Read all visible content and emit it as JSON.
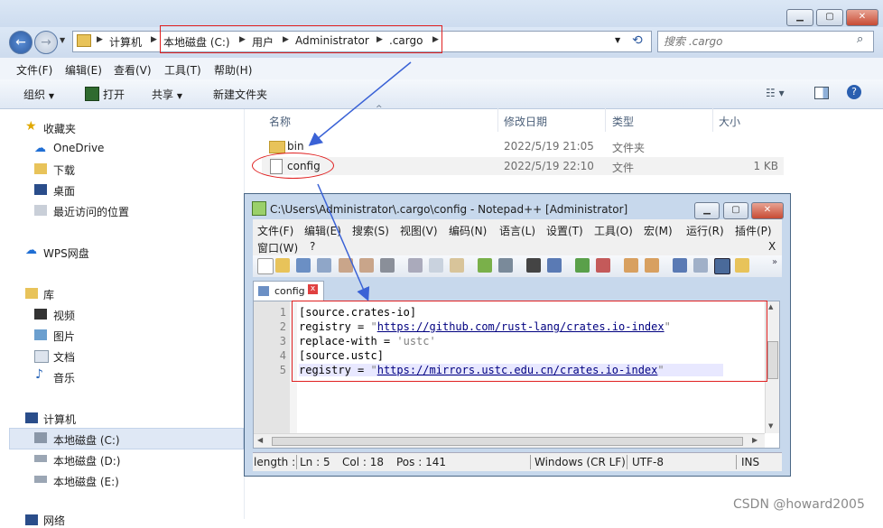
{
  "explorer": {
    "back_icon": "back-arrow-icon",
    "forward_icon": "forward-arrow-icon",
    "address": {
      "computer": "计算机",
      "drive": "本地磁盘 (C:)",
      "users": "用户",
      "admin": "Administrator",
      "folder": ".cargo"
    },
    "search_placeholder": "搜索 .cargo",
    "menu": [
      "文件(F)",
      "编辑(E)",
      "查看(V)",
      "工具(T)",
      "帮助(H)"
    ],
    "toolbar": {
      "organize": "组织",
      "open": "打开",
      "share": "共享",
      "new_folder": "新建文件夹"
    },
    "sidebar": {
      "favorites": "收藏夹",
      "onedrive": "OneDrive",
      "downloads": "下载",
      "desktop": "桌面",
      "recent": "最近访问的位置",
      "wps": "WPS网盘",
      "library": "库",
      "videos": "视频",
      "pictures": "图片",
      "documents": "文档",
      "music": "音乐",
      "computer": "计算机",
      "drive_c": "本地磁盘 (C:)",
      "drive_d": "本地磁盘 (D:)",
      "drive_e": "本地磁盘 (E:)",
      "network": "网络"
    },
    "columns": {
      "name": "名称",
      "date": "修改日期",
      "type": "类型",
      "size": "大小"
    },
    "files": [
      {
        "name": "bin",
        "date": "2022/5/19 21:05",
        "type": "文件夹",
        "size": ""
      },
      {
        "name": "config",
        "date": "2022/5/19 22:10",
        "type": "文件",
        "size": "1 KB"
      }
    ]
  },
  "notepad": {
    "title": "C:\\Users\\Administrator\\.cargo\\config - Notepad++ [Administrator]",
    "menu": [
      "文件(F)",
      "编辑(E)",
      "搜索(S)",
      "视图(V)",
      "编码(N)",
      "语言(L)",
      "设置(T)",
      "工具(O)",
      "宏(M)",
      "运行(R)",
      "插件(P)"
    ],
    "menu_row2": [
      "窗口(W)",
      "?"
    ],
    "close_x": "X",
    "tab": "config",
    "lines": [
      "1",
      "2",
      "3",
      "4",
      "5"
    ],
    "code": {
      "l1": "[source.crates-io]",
      "l2_key": "registry = ",
      "l2_q1": "\"",
      "l2_url": "https://github.com/rust-lang/crates.io-index",
      "l2_q2": "\"",
      "l3_key": "replace-with = ",
      "l3_val": "'ustc'",
      "l4": "[source.ustc]",
      "l5_key": "registry = ",
      "l5_q1": "\"",
      "l5_url": "https://mirrors.ustc.edu.cn/crates.io-index",
      "l5_q2": "\""
    },
    "status": {
      "length": "length :",
      "ln": "Ln : 5",
      "col": "Col : 18",
      "pos": "Pos : 141",
      "eol": "Windows (CR LF)",
      "enc": "UTF-8",
      "ins": "INS"
    }
  },
  "watermark": "CSDN @howard2005",
  "colors": {
    "annotation_red": "#e02020",
    "arrow_blue": "#3a62d6"
  }
}
